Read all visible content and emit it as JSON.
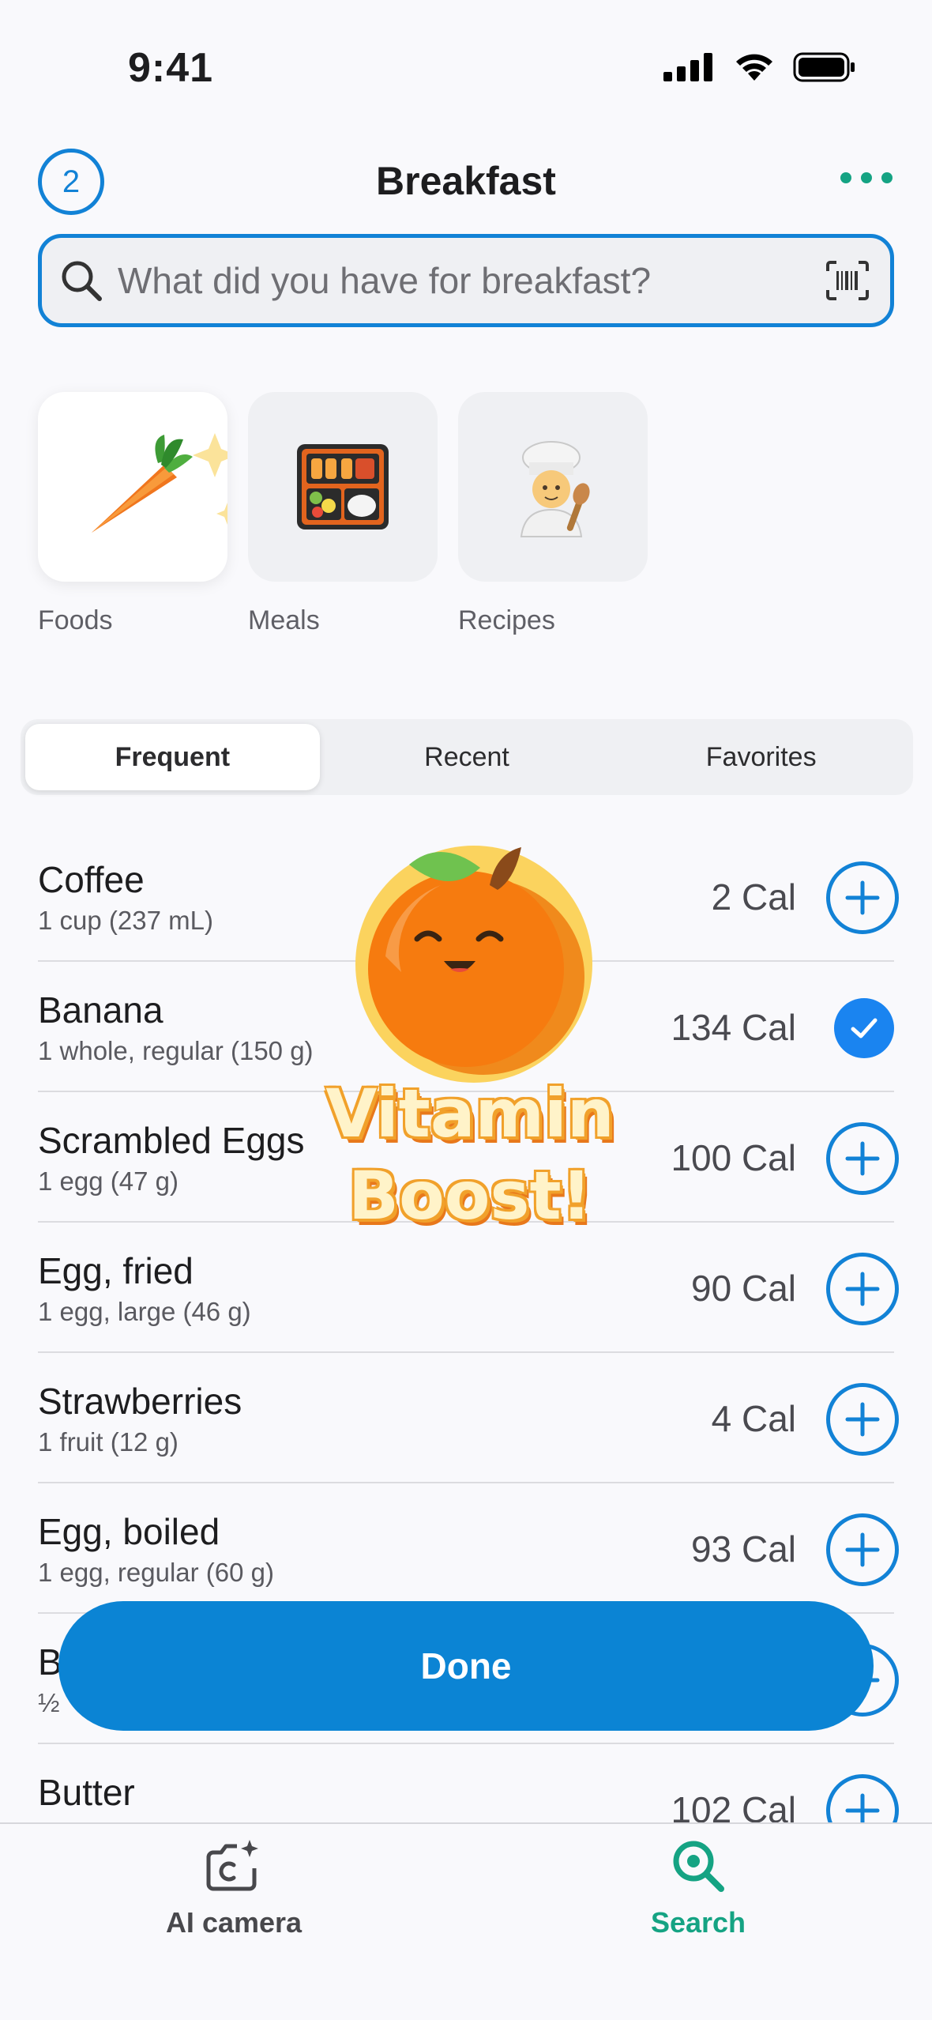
{
  "status_bar": {
    "time": "9:41"
  },
  "header": {
    "count": "2",
    "title": "Breakfast"
  },
  "search": {
    "placeholder": "What did you have for breakfast?"
  },
  "categories": [
    {
      "label": "Foods",
      "icon": "carrot-icon"
    },
    {
      "label": "Meals",
      "icon": "bento-box-icon"
    },
    {
      "label": "Recipes",
      "icon": "cook-icon"
    }
  ],
  "tabs": {
    "frequent": "Frequent",
    "recent": "Recent",
    "favorites": "Favorites",
    "selected": "Frequent"
  },
  "foods": [
    {
      "name": "Coffee",
      "serving": "1 cup (237 mL)",
      "calories": "2 Cal",
      "state": "add"
    },
    {
      "name": "Banana",
      "serving": "1 whole, regular (150 g)",
      "calories": "134 Cal",
      "state": "checked"
    },
    {
      "name": "Scrambled Eggs",
      "serving": "1 egg (47 g)",
      "calories": "100 Cal",
      "state": "add"
    },
    {
      "name": "Egg, fried",
      "serving": "1 egg, large (46 g)",
      "calories": "90 Cal",
      "state": "add"
    },
    {
      "name": "Strawberries",
      "serving": "1 fruit (12 g)",
      "calories": "4 Cal",
      "state": "add"
    },
    {
      "name": "Egg, boiled",
      "serving": "1 egg, regular (60 g)",
      "calories": "93 Cal",
      "state": "add"
    },
    {
      "name": "B",
      "serving": "½",
      "calories": "",
      "state": "add"
    },
    {
      "name": "Butter",
      "serving": "",
      "calories": "102 Cal",
      "state": "add"
    }
  ],
  "sticker": {
    "line1": "Vitamin",
    "line2": "Boost!"
  },
  "done_label": "Done",
  "tab_bar": {
    "camera_label": "AI camera",
    "search_label": "Search"
  },
  "colors": {
    "accent_blue": "#1282d6",
    "accent_green": "#15a383",
    "done_blue": "#0b84d4"
  }
}
